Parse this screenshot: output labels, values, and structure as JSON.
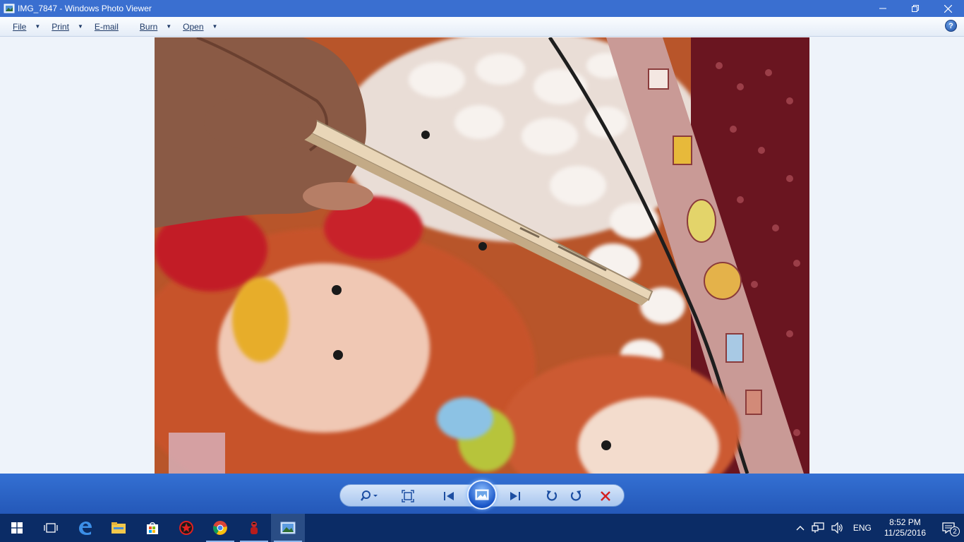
{
  "window": {
    "title": "IMG_7847 - Windows Photo Viewer"
  },
  "menu": {
    "items": [
      {
        "label": "File",
        "has_dropdown": true
      },
      {
        "label": "Print",
        "has_dropdown": true
      },
      {
        "label": "E-mail",
        "has_dropdown": false
      },
      {
        "label": "Burn",
        "has_dropdown": true
      },
      {
        "label": "Open",
        "has_dropdown": true
      }
    ],
    "help_label": "?"
  },
  "controls": {
    "zoom": "magnifier-icon",
    "actual_size": "actual-size-icon",
    "previous": "previous-icon",
    "slideshow": "slideshow-icon",
    "next": "next-icon",
    "rotate_ccw": "rotate-ccw-icon",
    "rotate_cw": "rotate-cw-icon",
    "delete": "delete-icon"
  },
  "taskbar": {
    "apps": [
      "start",
      "task-view",
      "edge",
      "file-explorer",
      "store",
      "red-app",
      "chrome",
      "game-app",
      "photo-viewer"
    ],
    "tray": {
      "language": "ENG",
      "time": "8:52 PM",
      "date": "11/25/2016",
      "notifications": "2"
    }
  },
  "colors": {
    "titlebar": "#3a6fd0",
    "controlbar": "#2d66c8",
    "taskbar": "#0b2c66",
    "delete": "#d42020"
  }
}
